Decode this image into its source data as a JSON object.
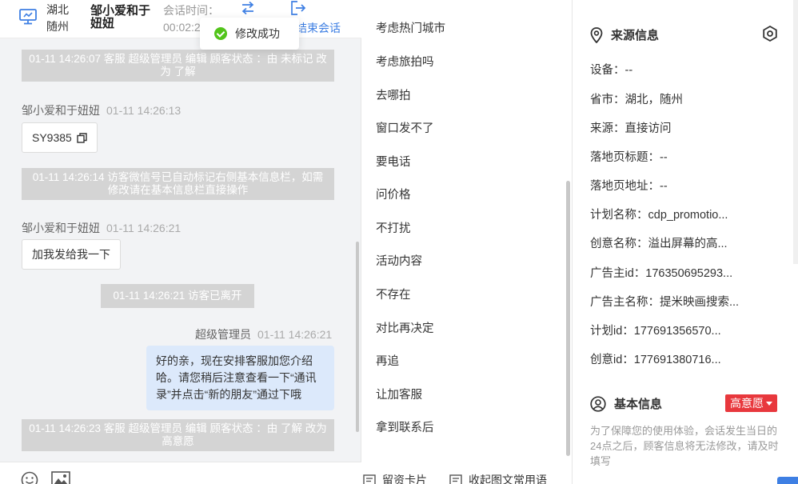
{
  "header": {
    "province": "湖北",
    "city": "随州",
    "visitor_name": "邹小爱和于妞妞",
    "session_label": "会话时间：",
    "session_value": "00:02:2",
    "end_session": "结束会话"
  },
  "toast": {
    "text": "修改成功"
  },
  "messages": {
    "sys1": "01-11 14:26:07 客服 超级管理员 编辑 顾客状态 ：由 未标记 改为 了解",
    "m1_sender": "邹小爱和于妞妞",
    "m1_time": "01-11 14:26:13",
    "m1_text": "SY9385",
    "sys2": "01-11 14:26:14 访客微信号已自动标记右侧基本信息栏，如需修改请在基本信息栏直接操作",
    "m2_sender": "邹小爱和于妞妞",
    "m2_time": "01-11 14:26:21",
    "m2_text": "加我发给我一下",
    "sys3": "01-11 14:26:21 访客已离开",
    "m3_sender": "超级管理员",
    "m3_time": "01-11 14:26:21",
    "m3_text": "好的亲，现在安排客服加您介绍哈。请您稍后注意查看一下“通讯录”并点击“新的朋友”通过下哦",
    "sys4": "01-11 14:26:23 客服 超级管理员 编辑 顾客状态 ：由 了解 改为 高意愿"
  },
  "quick_replies": [
    "考虑热门城市",
    "考虑旅拍吗",
    "去哪拍",
    "窗口发不了",
    "要电话",
    "问价格",
    "不打扰",
    "活动内容",
    "不存在",
    "对比再决定",
    "再追",
    "让加客服",
    "拿到联系后"
  ],
  "reply_footer": {
    "card": "留资卡片",
    "collect": "收起图文常用语"
  },
  "source_info": {
    "title": "来源信息",
    "device": "设备：--",
    "region": "省市：湖北，随州",
    "source": "来源：直接访问",
    "landing_title": "落地页标题：--",
    "landing_url": "落地页地址：--",
    "plan_name": "计划名称：cdp_promotio...",
    "creative_name": "创意名称：溢出屏幕的高...",
    "advertiser_id": "广告主id：176350695293...",
    "advertiser_name": "广告主名称：提米映画搜索...",
    "plan_id": "计划id：177691356570...",
    "creative_id": "创意id：177691380716..."
  },
  "basic_info": {
    "title": "基本信息",
    "intent": "高意愿",
    "notice": "为了保障您的使用体验，会话发生当日的24点之后，顾客信息将无法修改，请及时填写"
  },
  "colors": {
    "accent": "#3e7fe3",
    "system_msg_bg": "#d4d4d4",
    "agent_bubble": "#dce9fb",
    "intent_badge": "#e8383d",
    "success": "#52c41a"
  }
}
